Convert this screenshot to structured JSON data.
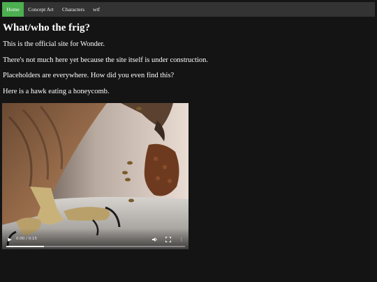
{
  "nav": {
    "items": [
      {
        "label": "Home",
        "active": true
      },
      {
        "label": "Concept Art",
        "active": false
      },
      {
        "label": "Characters",
        "active": false
      },
      {
        "label": "wtf",
        "active": false
      }
    ]
  },
  "main": {
    "heading": "What/who the frig?",
    "paragraphs": [
      "This is the official site for Wonder.",
      "There's not much here yet because the site itself is under construction.",
      "Placeholders are everywhere. How did you even find this?",
      "Here is a hawk eating a honeycomb."
    ]
  },
  "video": {
    "time": "0:00 / 0:15",
    "progress": 0.0,
    "buffered": 0.21,
    "icons": {
      "play": "play-icon",
      "volume": "volume-icon",
      "fullscreen": "fullscreen-icon",
      "more": "more-options-icon"
    }
  },
  "colors": {
    "background": "#141414",
    "nav_bar": "#333333",
    "nav_active": "#4caf50",
    "text": "#ffffff"
  }
}
